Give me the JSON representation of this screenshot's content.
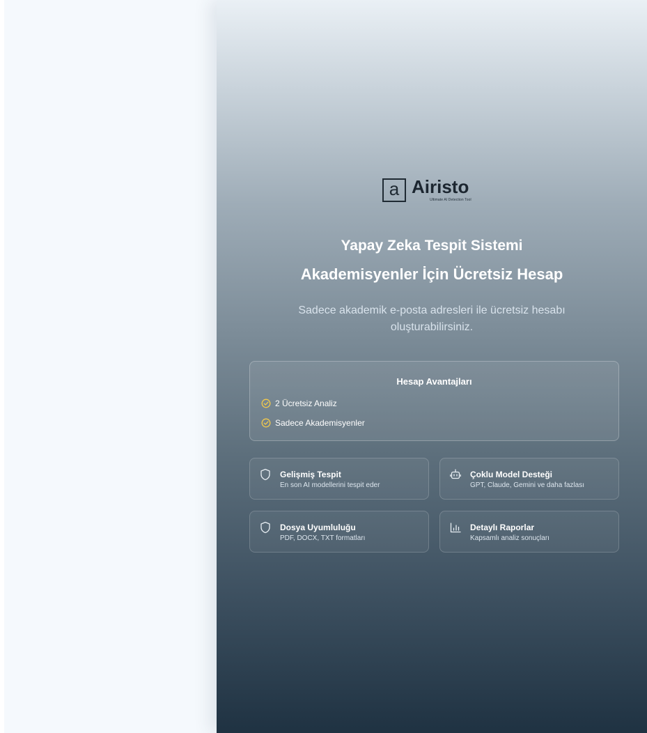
{
  "brand": {
    "logo_letter": "a",
    "name": "Airisto",
    "tagline": "Ultimate AI Detection Tool"
  },
  "hero": {
    "title_line1": "Yapay Zeka Tespit Sistemi",
    "title_line2": "Akademisyenler İçin Ücretsiz Hesap",
    "subtitle": "Sadece akademik e-posta adresleri ile ücretsiz hesabı oluşturabilirsiniz."
  },
  "benefits": {
    "title": "Hesap Avantajları",
    "items": [
      {
        "label": "2 Ücretsiz Analiz",
        "icon": "check-circle-icon"
      },
      {
        "label": "Sadece Akademisyenler",
        "icon": "check-circle-icon"
      }
    ]
  },
  "features": [
    {
      "title": "Gelişmiş Tespit",
      "desc": "En son AI modellerini tespit eder",
      "icon": "shield-icon"
    },
    {
      "title": "Çoklu Model Desteği",
      "desc": "GPT, Claude, Gemini ve daha fazlası",
      "icon": "robot-icon"
    },
    {
      "title": "Dosya Uyumluluğu",
      "desc": "PDF, DOCX, TXT formatları",
      "icon": "shield-icon"
    },
    {
      "title": "Detaylı Raporlar",
      "desc": "Kapsamlı analiz sonuçları",
      "icon": "bar-chart-icon"
    }
  ],
  "colors": {
    "accent_check": "#f2c94c",
    "panel_top": "#eaf0f5",
    "panel_bottom": "#1f3242"
  }
}
